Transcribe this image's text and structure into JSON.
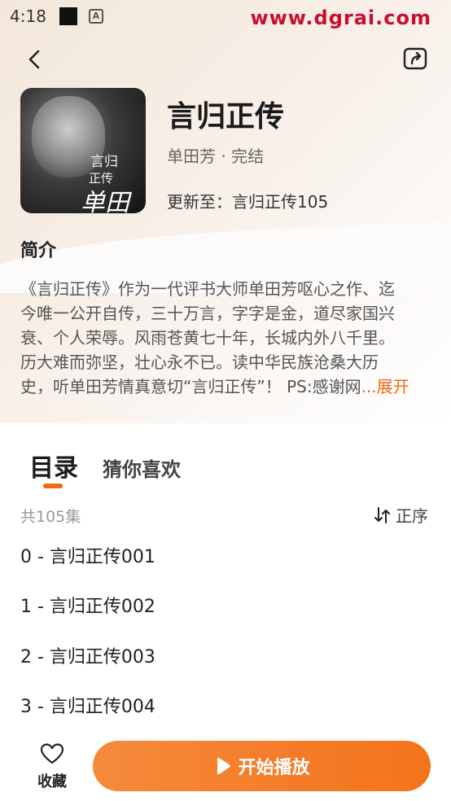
{
  "status_bar": {
    "time": "4:18",
    "icon": "a-box-icon"
  },
  "watermark": "www.dgrai.com",
  "header": {
    "back_icon": "chevron-left-icon",
    "share_icon": "screen-share-icon"
  },
  "book": {
    "cover_text_1": "言归",
    "cover_text_2": "正传",
    "cover_signature": "单田芳",
    "title": "言归正传",
    "author_status": "单田芳 · 完结",
    "update": "更新至：言归正传105"
  },
  "intro": {
    "heading": "简介",
    "lines": [
      "《言归正传》作为一代评书大师单田芳呕心之作、迄",
      "今唯一公开自传，三十万言，字字是金，道尽家国兴",
      "衰、个人荣辱。风雨苍黄七十年，长城内外八千里。",
      "历大难而弥坚，壮心永不已。读中华民族沧桑大历"
    ],
    "last_line": "史，听单田芳情真意切“言归正传”！ PS:感谢网",
    "more": "...展开"
  },
  "tabs": [
    {
      "label": "目录",
      "active": true
    },
    {
      "label": "猜你喜欢",
      "active": false
    }
  ],
  "catalog": {
    "count": "共105集",
    "sort_label": "正序",
    "episodes": [
      "0 - 言归正传001",
      "1 - 言归正传002",
      "2 - 言归正传003",
      "3 - 言归正传004"
    ]
  },
  "bottom": {
    "fav_label": "收藏",
    "play_label": "开始播放"
  },
  "colors": {
    "accent": "#f26a0f",
    "play_button": "#f4731b"
  }
}
